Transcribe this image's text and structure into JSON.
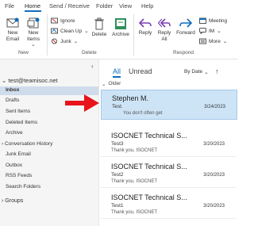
{
  "menu": {
    "tabs": [
      "File",
      "Home",
      "Send / Receive",
      "Folder",
      "View",
      "Help"
    ],
    "active": "Home"
  },
  "ribbon": {
    "new_email": "New Email",
    "new_items": "New Items",
    "ignore": "Ignore",
    "clean_up": "Clean Up",
    "junk": "Junk",
    "delete": "Delete",
    "archive": "Archive",
    "reply": "Reply",
    "reply_all": "Reply All",
    "forward": "Forward",
    "meeting": "Meeting",
    "im": "IM",
    "more": "More",
    "groups": {
      "new": "New",
      "delete": "Delete",
      "respond": "Respond"
    }
  },
  "account": "test@teamisoc.net",
  "folders": [
    "Inbox",
    "Drafts",
    "Sent Items",
    "Deleted Items",
    "Archive",
    "Conversation History",
    "Junk Email",
    "Outbox",
    "RSS Feeds",
    "Search Folders"
  ],
  "groups_label": "Groups",
  "list": {
    "filter_all": "All",
    "filter_unread": "Unread",
    "sort": "By Date",
    "section": "Older",
    "messages": [
      {
        "sender": "Stephen M.",
        "subject": "Test.",
        "date": "3/24/2023",
        "preview": "You don't often get",
        "selected": true
      },
      {
        "sender": "ISOCNET Technical S...",
        "subject": "Test3",
        "date": "3/20/2023",
        "preview": "Thank you,   ISOCNET",
        "selected": false
      },
      {
        "sender": "ISOCNET Technical S...",
        "subject": "Test2",
        "date": "3/20/2023",
        "preview": "Thank you,   ISOCNET",
        "selected": false
      },
      {
        "sender": "ISOCNET Technical S...",
        "subject": "Test1",
        "date": "3/20/2023",
        "preview": "Thank you,   ISOCNET",
        "selected": false
      }
    ]
  },
  "colors": {
    "accent": "#0F6CBD",
    "selected_msg": "#cde4f7",
    "selected_folder": "#cfdcec",
    "arrow": "#e8131b"
  }
}
